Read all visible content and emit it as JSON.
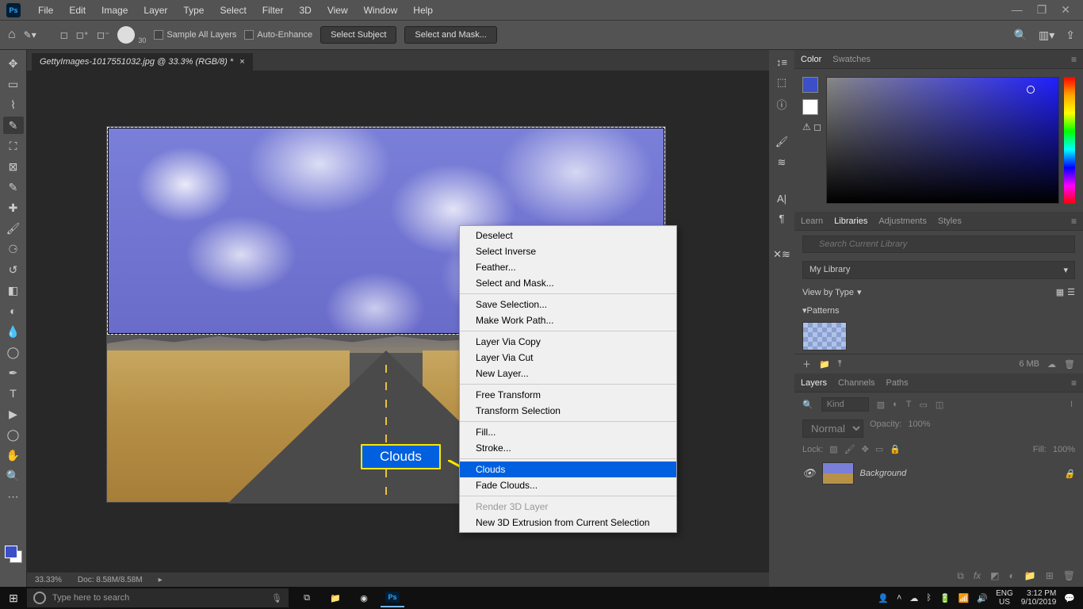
{
  "menu": {
    "items": [
      "File",
      "Edit",
      "Image",
      "Layer",
      "Type",
      "Select",
      "Filter",
      "3D",
      "View",
      "Window",
      "Help"
    ]
  },
  "options_bar": {
    "brush_size": "30",
    "sample_all": "Sample All Layers",
    "auto_enhance": "Auto-Enhance",
    "select_subject": "Select Subject",
    "select_mask": "Select and Mask..."
  },
  "document": {
    "tab_title": "GettyImages-1017551032.jpg @ 33.3% (RGB/8) *",
    "zoom": "33.33%",
    "doc_info": "Doc: 8.58M/8.58M"
  },
  "callout": {
    "label": "Clouds"
  },
  "context_menu": {
    "items": [
      {
        "label": "Deselect"
      },
      {
        "label": "Select Inverse"
      },
      {
        "label": "Feather..."
      },
      {
        "label": "Select and Mask..."
      },
      {
        "sep": true
      },
      {
        "label": "Save Selection..."
      },
      {
        "label": "Make Work Path..."
      },
      {
        "sep": true
      },
      {
        "label": "Layer Via Copy"
      },
      {
        "label": "Layer Via Cut"
      },
      {
        "label": "New Layer..."
      },
      {
        "sep": true
      },
      {
        "label": "Free Transform"
      },
      {
        "label": "Transform Selection"
      },
      {
        "sep": true
      },
      {
        "label": "Fill..."
      },
      {
        "label": "Stroke..."
      },
      {
        "sep": true
      },
      {
        "label": "Clouds",
        "highlight": true
      },
      {
        "label": "Fade Clouds..."
      },
      {
        "sep": true
      },
      {
        "label": "Render 3D Layer",
        "disabled": true
      },
      {
        "label": "New 3D Extrusion from Current Selection"
      }
    ]
  },
  "panels": {
    "color_tab": "Color",
    "swatches_tab": "Swatches",
    "lib_tabs": [
      "Learn",
      "Libraries",
      "Adjustments",
      "Styles"
    ],
    "lib_active": 1,
    "lib_search_placeholder": "Search Current Library",
    "lib_selected": "My Library",
    "view_by": "View by Type",
    "patterns_label": "Patterns",
    "lib_size": "6 MB",
    "layer_tabs": [
      "Layers",
      "Channels",
      "Paths"
    ],
    "layer_active": 0,
    "filter_kind": "Kind",
    "blend_mode": "Normal",
    "opacity_label": "Opacity:",
    "opacity_val": "100%",
    "lock_label": "Lock:",
    "fill_label": "Fill:",
    "fill_val": "100%",
    "layer_name": "Background"
  },
  "taskbar": {
    "search_placeholder": "Type here to search",
    "lang": "ENG",
    "locale": "US",
    "time": "3:12 PM",
    "date": "9/10/2019"
  }
}
